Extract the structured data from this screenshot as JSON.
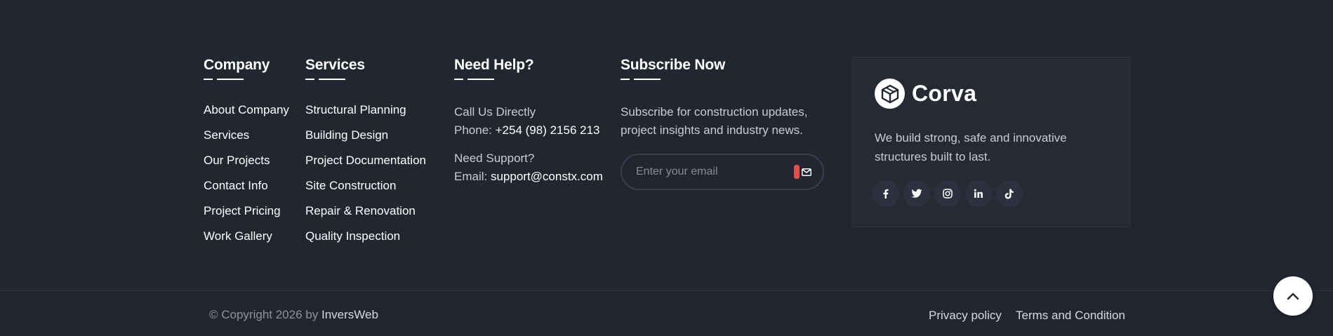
{
  "company": {
    "title": "Company",
    "links": [
      "About Company",
      "Services",
      "Our Projects",
      "Contact Info",
      "Project Pricing",
      "Work Gallery"
    ]
  },
  "services": {
    "title": "Services",
    "links": [
      "Structural Planning",
      "Building Design",
      "Project Documentation",
      "Site Construction",
      "Repair & Renovation",
      "Quality Inspection"
    ]
  },
  "help": {
    "title": "Need Help?",
    "call_label": "Call Us Directly",
    "phone_prefix": "Phone:",
    "phone": "+254 (98) 2156 213",
    "support_label": "Need Support?",
    "email_prefix": "Email:",
    "email": "support@constx.com"
  },
  "subscribe": {
    "title": "Subscribe Now",
    "text": "Subscribe for construction updates, project insights and industry news.",
    "placeholder": "Enter your email"
  },
  "brand": {
    "name": "Corva",
    "description": "We build strong, safe and innovative structures built to last.",
    "socials": [
      "facebook-icon",
      "twitter-icon",
      "instagram-icon",
      "linkedin-icon",
      "tiktok-icon"
    ]
  },
  "bottom": {
    "copyright_prefix": "© Copyright 2026 by",
    "copyright_link": "InversWeb",
    "privacy": "Privacy policy",
    "terms": "Terms and Condition"
  },
  "colors": {
    "background": "#222631",
    "card": "#252a35",
    "accent_red": "#e64b4b"
  }
}
